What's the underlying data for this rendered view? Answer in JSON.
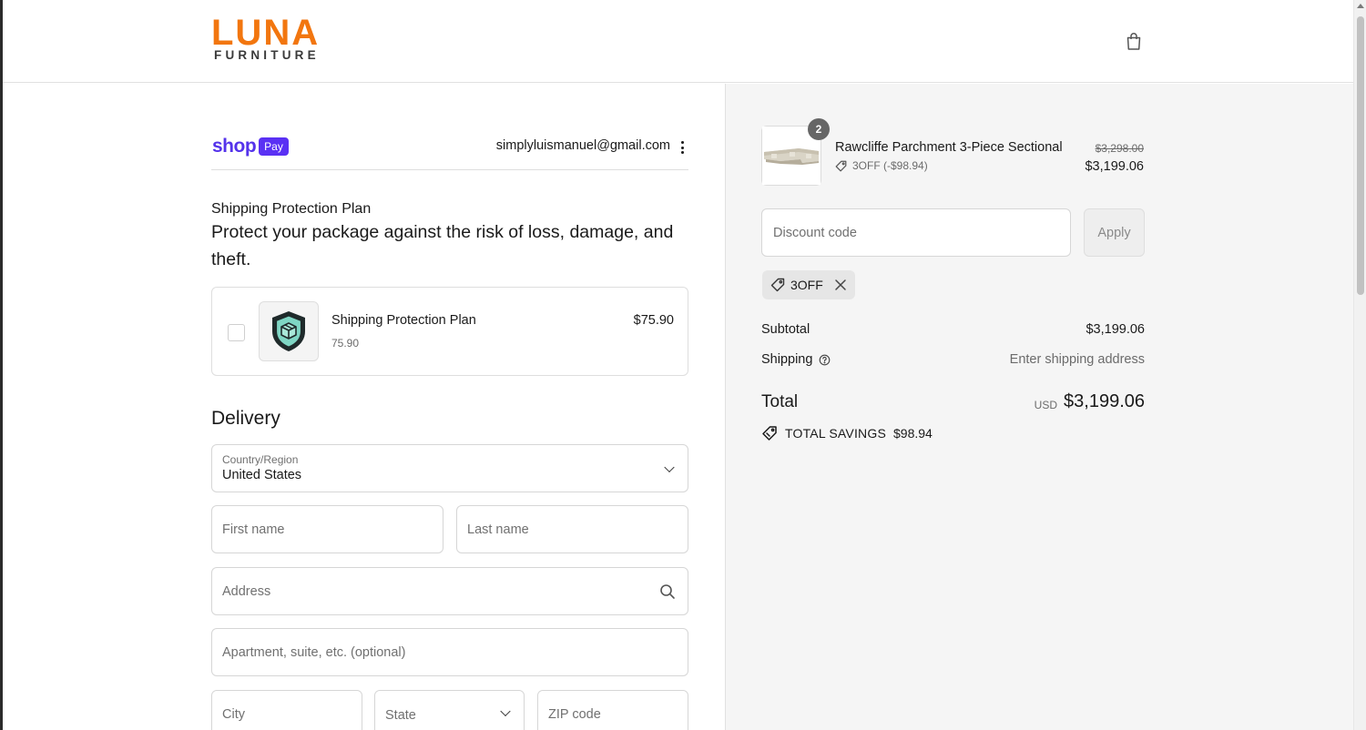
{
  "brand": {
    "name": "LUNA",
    "subtitle": "FURNITURE",
    "accent_color": "#f2760f"
  },
  "header": {
    "cart_icon": "shopping-bag-icon"
  },
  "express": {
    "shop_label": "shop",
    "pay_label": "Pay",
    "email": "simplyluismanuel@gmail.com",
    "menu_icon": "more-vertical-icon",
    "brand_color": "#5a31f4"
  },
  "protection": {
    "heading": "Shipping Protection Plan",
    "description": "Protect your package against the risk of loss, damage, and theft.",
    "item_name": "Shipping Protection Plan",
    "item_sub": "75.90",
    "item_price": "$75.90",
    "checked": false,
    "icon": "shield-package-icon"
  },
  "delivery": {
    "heading": "Delivery",
    "country_label": "Country/Region",
    "country_value": "United States",
    "first_name_placeholder": "First name",
    "last_name_placeholder": "Last name",
    "address_placeholder": "Address",
    "apartment_placeholder": "Apartment, suite, etc. (optional)",
    "city_placeholder": "City",
    "state_placeholder": "State",
    "zip_placeholder": "ZIP code"
  },
  "summary": {
    "product": {
      "name": "Rawcliffe Parchment 3-Piece Sectional",
      "quantity": "2",
      "discount": "3OFF (-$98.94)",
      "original_price": "$3,298.00",
      "price": "$3,199.06"
    },
    "discount_placeholder": "Discount code",
    "apply_label": "Apply",
    "applied_code": "3OFF",
    "subtotal_label": "Subtotal",
    "subtotal_value": "$3,199.06",
    "shipping_label": "Shipping",
    "shipping_value": "Enter shipping address",
    "total_label": "Total",
    "currency": "USD",
    "total_value": "$3,199.06",
    "savings_label": "TOTAL SAVINGS",
    "savings_value": "$98.94"
  }
}
